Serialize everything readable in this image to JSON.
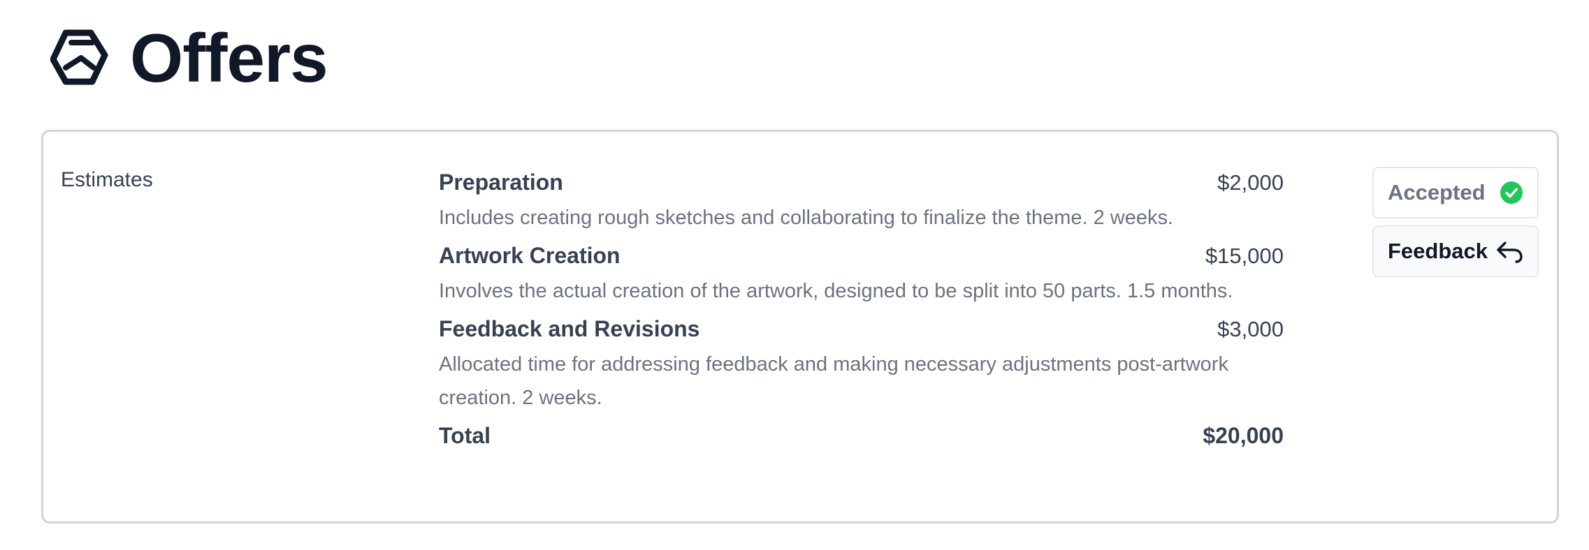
{
  "page": {
    "title": "Offers"
  },
  "card": {
    "label": "Estimates",
    "items": [
      {
        "name": "Preparation",
        "price": "$2,000",
        "description": "Includes creating rough sketches and collaborating to finalize the theme. 2 weeks."
      },
      {
        "name": "Artwork Creation",
        "price": "$15,000",
        "description": "Involves the actual creation of the artwork, designed to be split into 50 parts. 1.5 months."
      },
      {
        "name": "Feedback and Revisions",
        "price": "$3,000",
        "description": "Allocated time for addressing feedback and making necessary adjustments post-artwork creation. 2 weeks."
      }
    ],
    "total": {
      "label": "Total",
      "value": "$20,000"
    }
  },
  "actions": {
    "accepted_label": "Accepted",
    "accepted_icon": "check-circle-icon",
    "feedback_label": "Feedback",
    "feedback_icon": "reply-arrow-icon"
  },
  "colors": {
    "accent_success": "#22c55e",
    "title": "#111827",
    "border": "#d1d5db"
  }
}
